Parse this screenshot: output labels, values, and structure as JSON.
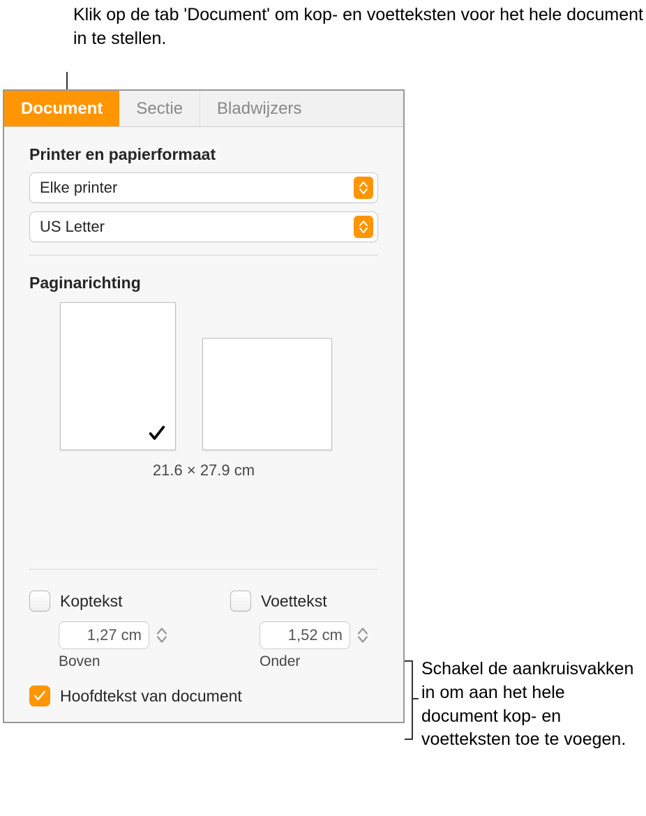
{
  "callouts": {
    "top": "Klik op de tab 'Document' om kop- en voetteksten voor het hele document in te stellen.",
    "right": "Schakel de aankruisvakken in om aan het hele document kop- en voetteksten toe te voegen."
  },
  "tabs": {
    "document": "Document",
    "sectie": "Sectie",
    "bladwijzers": "Bladwijzers"
  },
  "printer_section": {
    "heading": "Printer en papierformaat",
    "printer_value": "Elke printer",
    "paper_value": "US Letter"
  },
  "orientation": {
    "heading": "Paginarichting",
    "size_text": "21.6 × 27.9 cm"
  },
  "header_footer": {
    "koptekst_label": "Koptekst",
    "voettekst_label": "Voettekst",
    "koptekst_value": "1,27 cm",
    "voettekst_value": "1,52 cm",
    "boven_label": "Boven",
    "onder_label": "Onder"
  },
  "mainbody": {
    "label": "Hoofdtekst van document"
  }
}
